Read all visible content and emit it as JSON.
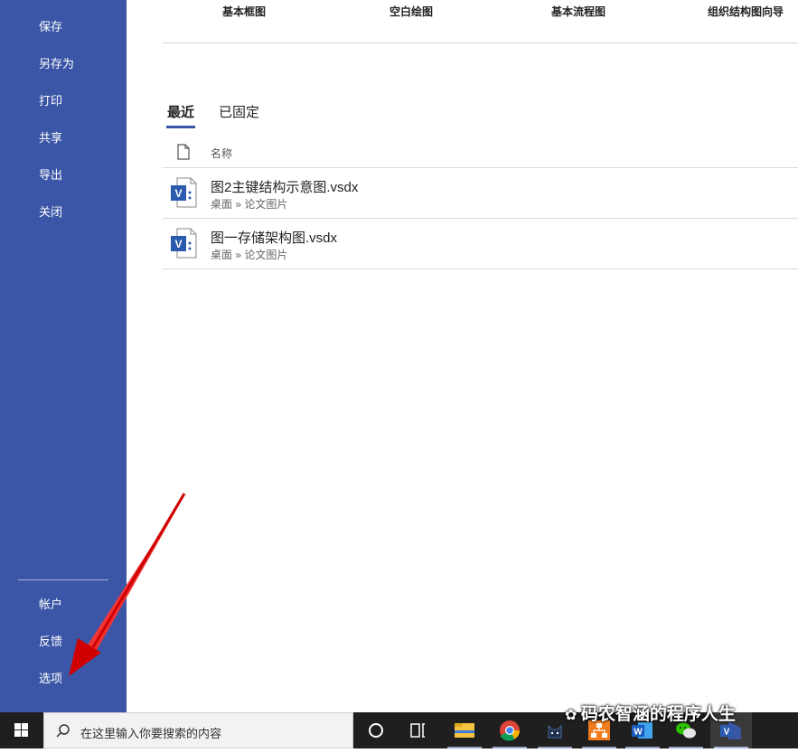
{
  "sidebar": {
    "items": [
      {
        "label": "保存"
      },
      {
        "label": "另存为"
      },
      {
        "label": "打印"
      },
      {
        "label": "共享"
      },
      {
        "label": "导出"
      },
      {
        "label": "关闭"
      }
    ],
    "bottom_items": [
      {
        "label": "帐户"
      },
      {
        "label": "反馈"
      },
      {
        "label": "选项"
      }
    ]
  },
  "templates": [
    {
      "label": "基本框图"
    },
    {
      "label": "空白绘图"
    },
    {
      "label": "基本流程图"
    },
    {
      "label": "组织结构图向导"
    }
  ],
  "tabs": [
    {
      "label": "最近"
    },
    {
      "label": "已固定"
    }
  ],
  "table": {
    "header": "名称",
    "files": [
      {
        "name": "图2主键结构示意图.vsdx",
        "path": "桌面 » 论文图片"
      },
      {
        "name": "图一存储架构图.vsdx",
        "path": "桌面 » 论文图片"
      }
    ]
  },
  "taskbar": {
    "search_placeholder": "在这里输入你要搜索的内容",
    "apps": [
      "cortana-icon",
      "task-view-icon",
      "file-explorer-icon",
      "chrome-icon",
      "cat-app-icon",
      "network-app-icon",
      "word-icon",
      "wechat-icon",
      "visio-icon"
    ]
  },
  "watermark": "码农智涵的程序人生",
  "colors": {
    "sidebar": "#3b56a6",
    "accent": "#3b56a6",
    "taskbar": "#1f1f1f",
    "visio_blue": "#2b5aae"
  }
}
